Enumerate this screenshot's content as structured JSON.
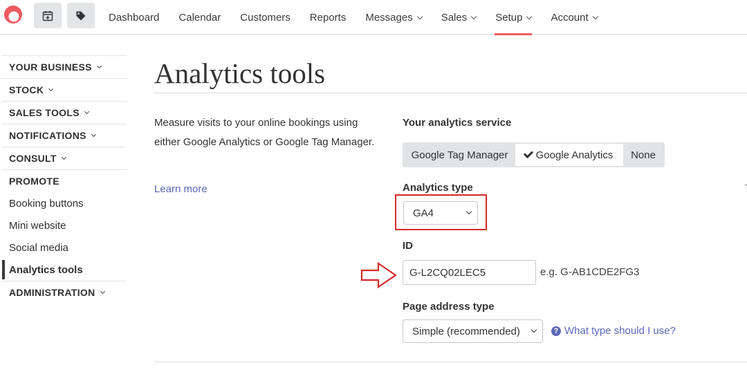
{
  "colors": {
    "accent": "#ee5a5f",
    "link": "#5b67b6",
    "highlight": "#d42a2a"
  },
  "header": {
    "logo": "app-logo",
    "nav": [
      {
        "label": "Dashboard",
        "dropdown": false
      },
      {
        "label": "Calendar",
        "dropdown": false
      },
      {
        "label": "Customers",
        "dropdown": false
      },
      {
        "label": "Reports",
        "dropdown": false
      },
      {
        "label": "Messages",
        "dropdown": true
      },
      {
        "label": "Sales",
        "dropdown": true
      },
      {
        "label": "Setup",
        "dropdown": true,
        "active": true
      },
      {
        "label": "Account",
        "dropdown": true
      }
    ]
  },
  "sidebar": {
    "sections": [
      {
        "label": "YOUR BUSINESS"
      },
      {
        "label": "STOCK"
      },
      {
        "label": "SALES TOOLS"
      },
      {
        "label": "NOTIFICATIONS"
      },
      {
        "label": "CONSULT"
      },
      {
        "label": "PROMOTE"
      },
      {
        "label": "ADMINISTRATION"
      }
    ],
    "promote_links": [
      {
        "label": "Booking buttons"
      },
      {
        "label": "Mini website"
      },
      {
        "label": "Social media"
      },
      {
        "label": "Analytics tools",
        "current": true
      }
    ]
  },
  "main": {
    "title": "Analytics tools",
    "description": "Measure visits to your online bookings using either Google Analytics or Google Tag Manager.",
    "learn_more": "Learn more",
    "service_label": "Your analytics service",
    "service_options": [
      "Google Tag Manager",
      "Google Analytics",
      "None"
    ],
    "service_selected": "Google Analytics",
    "type_label": "Analytics type",
    "type_value": "GA4",
    "id_label": "ID",
    "id_value": "G-L2CQ02LEC5",
    "id_example": "e.g. G-AB1CDE2FG3",
    "address_label": "Page address type",
    "address_value": "Simple (recommended)",
    "help_link": "What type should I use?"
  }
}
